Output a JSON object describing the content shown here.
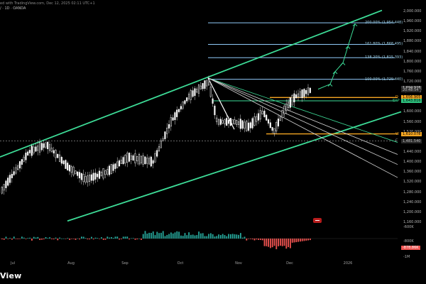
{
  "header": {
    "info_text": "ed with TradingView.com, Dec 12, 2025 02:11 UTC+1",
    "symbol_text": "/ · 1D · OANDA"
  },
  "brand": {
    "text": "View"
  },
  "y_axis": {
    "labels": [
      "2,000.000",
      "1,960.000",
      "1,920.000",
      "1,880.000",
      "1,840.000",
      "1,800.000",
      "1,760.000",
      "1,720.000",
      "1,680.000",
      "1,640.000",
      "1,600.000",
      "1,560.000",
      "1,520.000",
      "1,480.000",
      "1,440.000",
      "1,400.000",
      "1,360.000",
      "1,320.000",
      "1,280.000",
      "1,240.000",
      "1,200.000",
      "1,160.000"
    ]
  },
  "x_axis": {
    "labels": [
      "Jul",
      "Aug",
      "Sep",
      "Oct",
      "Nov",
      "Dec",
      "2026"
    ]
  },
  "fib_levels": [
    {
      "label": "100.00% (1,729.440)",
      "value": 1729.44
    },
    {
      "label": "138.20% (1,815.393)",
      "value": 1815.393
    },
    {
      "label": "161.80% (1,868.495)",
      "value": 1868.495
    },
    {
      "label": "200.00% (1,954.448)",
      "value": 1954.448
    }
  ],
  "price_tags": [
    {
      "text": "1,694.928",
      "style": "gray",
      "value": 1694.9
    },
    {
      "text": "20:48:54",
      "style": "gray2",
      "value": 1686
    },
    {
      "text": "1,656.905",
      "style": "orange",
      "value": 1656.9
    },
    {
      "text": "1,643.816",
      "style": "green",
      "value": 1643.8
    },
    {
      "text": "1,610.078",
      "style": "orange",
      "value": 1512
    },
    {
      "text": "1,481.540",
      "style": "gray2",
      "value": 1481.5
    }
  ],
  "level_markers": [
    {
      "text": "D",
      "color": "#f5a623",
      "value": 1656.9
    },
    {
      "text": "EXP",
      "color": "#2ec27e",
      "value": 1643.8
    },
    {
      "text": "W",
      "color": "#f5a623",
      "value": 1512
    },
    {
      "text": "C",
      "color": "#9e9e9e",
      "value": 1484
    }
  ],
  "indicator": {
    "labels": [
      "-600K",
      "-800K",
      "-1M"
    ],
    "value_tag": "-878.86K"
  },
  "colors": {
    "up": "#ffffff",
    "down": "#ffffff",
    "channel": "#3ddc97",
    "fib": "#90caf9",
    "projection": "#3ddc97",
    "orange": "#f5a623",
    "ind_pos": "#26a69a",
    "ind_neg": "#ef5350"
  }
}
